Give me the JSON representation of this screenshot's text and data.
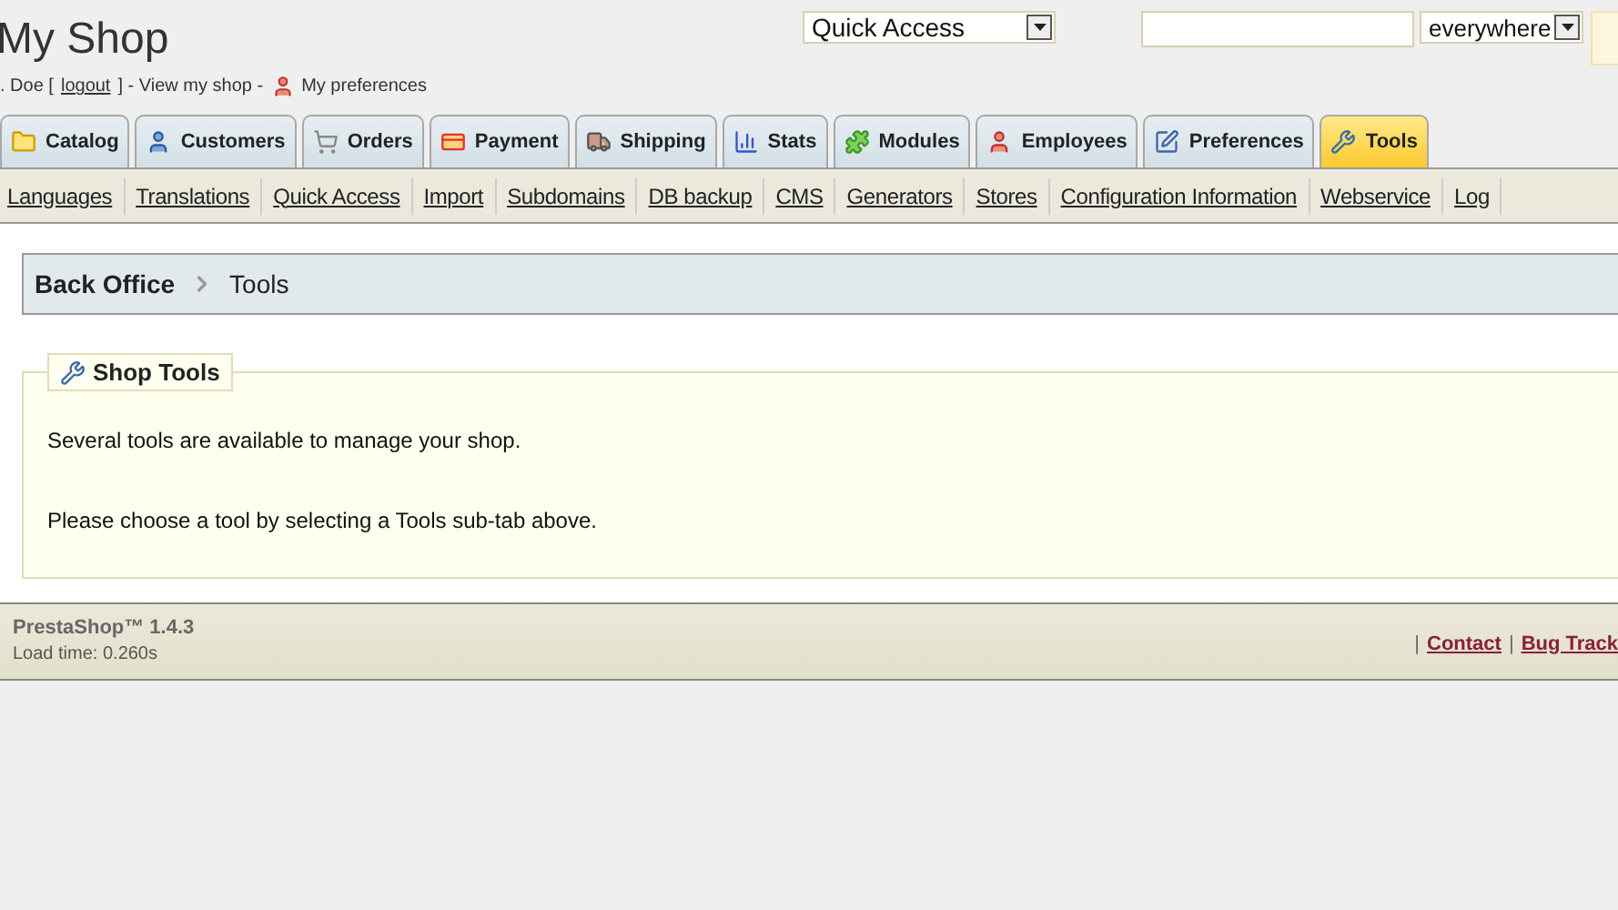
{
  "header": {
    "title": "My Shop",
    "user_prefix": ". Doe [",
    "logout": "logout",
    "user_middle": "] - View my shop -",
    "preferences": "My preferences",
    "quick_access": "Quick Access",
    "search_scope": "everywhere"
  },
  "tabs": [
    {
      "label": "Catalog",
      "selected": false
    },
    {
      "label": "Customers",
      "selected": false
    },
    {
      "label": "Orders",
      "selected": false
    },
    {
      "label": "Payment",
      "selected": false
    },
    {
      "label": "Shipping",
      "selected": false
    },
    {
      "label": "Stats",
      "selected": false
    },
    {
      "label": "Modules",
      "selected": false
    },
    {
      "label": "Employees",
      "selected": false
    },
    {
      "label": "Preferences",
      "selected": false
    },
    {
      "label": "Tools",
      "selected": true
    }
  ],
  "subtabs": [
    "Languages",
    "Translations",
    "Quick Access",
    "Import",
    "Subdomains",
    "DB backup",
    "CMS",
    "Generators",
    "Stores",
    "Configuration Information",
    "Webservice",
    "Log"
  ],
  "breadcrumb": [
    "Back Office",
    "Tools"
  ],
  "panel": {
    "legend": "Shop Tools",
    "paragraphs": [
      "Several tools are available to manage your shop.",
      "Please choose a tool by selecting a Tools sub-tab above."
    ]
  },
  "footer": {
    "version": "PrestaShop™ 1.4.3",
    "load_time": "Load time: 0.260s",
    "separator": "|",
    "links": [
      "Contact",
      "Bug Track"
    ]
  }
}
